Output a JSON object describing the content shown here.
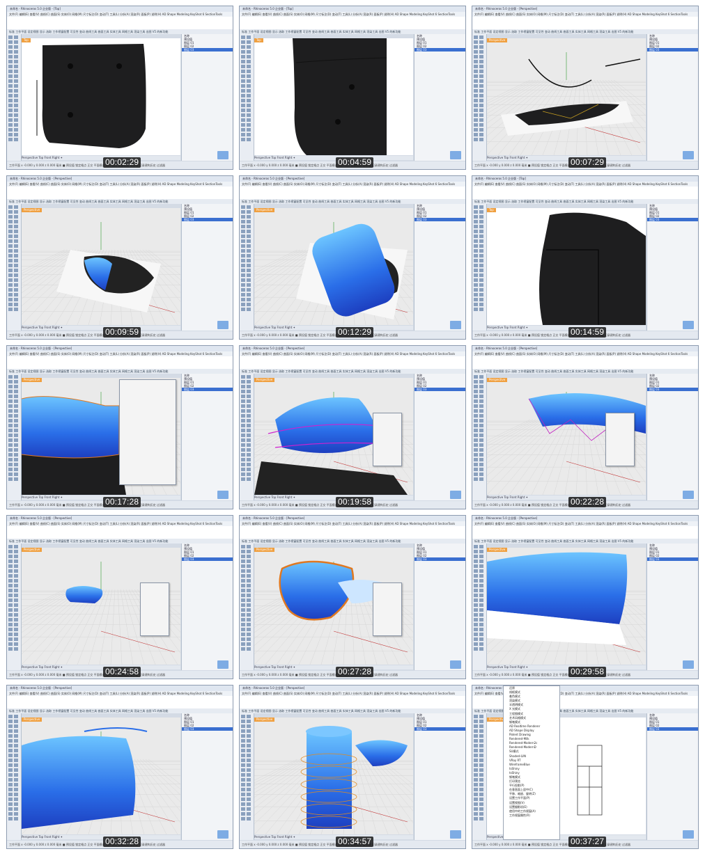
{
  "app": {
    "title_base": "未命名 - Rhinoceros 5.0 企业版",
    "menu": "文件(F)  编辑(E)  查看(V)  曲线(C)  曲面(S)  实体(O)  网格(M)  尺寸标注(D)  变动(T)  工具(L)  分析(A)  渲染(R)  面板(P)  说明(H)  AD Shape Modeling  KeyShot 6  SectionTools",
    "toolbar_tabs": "标准  工作平面  设定视图  显示  选取  工作视窗配置  可见性  变动  曲线工具  曲面工具  实体工具  网格工具  渲染工具  出图  V5 的新功能",
    "viewport_tabs": "Perspective  Top  Front  Right  ✦",
    "status": "工作平面  x -0.000  y 0.000  z 0.000  毫米  ■ 预设值  锁定格点  正交  平面模式  物件锁点  智慧轨迹  操作轴  记录建构历史  过滤器",
    "layers": [
      "名称",
      "预设值",
      "图层 01",
      "图层 02",
      "图层 03"
    ]
  },
  "tiles": [
    {
      "title": "未命名 - Rhinoceros 5.0 企业版 - [Top]",
      "viewport": "Top",
      "timestamp": "00:02:29",
      "scene": "dark-top"
    },
    {
      "title": "未命名 - Rhinoceros 5.0 企业版 - [Top]",
      "viewport": "Top",
      "timestamp": "00:04:59",
      "scene": "dark-top-zoom"
    },
    {
      "title": "未命名 - Rhinoceros 5.0 企业版 - [Perspective]",
      "viewport": "Perspective",
      "timestamp": "00:07:29",
      "scene": "perspective-curves"
    },
    {
      "title": "未命名 - Rhinoceros 5.0 企业版 - [Perspective]",
      "viewport": "Perspective",
      "timestamp": "00:09:59",
      "scene": "perspective-mouse"
    },
    {
      "title": "未命名 - Rhinoceros 5.0 企业版 - [Perspective]",
      "viewport": "Perspective",
      "timestamp": "00:12:29",
      "scene": "perspective-blue"
    },
    {
      "title": "未命名 - Rhinoceros 5.0 企业版 - [Top]",
      "viewport": "Top",
      "timestamp": "00:14:59",
      "scene": "dark-top-curve"
    },
    {
      "title": "未命名 - Rhinoceros 5.0 企业版 - [Perspective]",
      "viewport": "Perspective",
      "timestamp": "00:17:28",
      "scene": "blue-dialog"
    },
    {
      "title": "未命名 - Rhinoceros 5.0 企业版 - [Perspective]",
      "viewport": "Perspective",
      "timestamp": "00:19:58",
      "scene": "blue-magenta"
    },
    {
      "title": "未命名 - Rhinoceros 5.0 企业版 - [Perspective]",
      "viewport": "Perspective",
      "timestamp": "00:22:28",
      "scene": "blue-cage"
    },
    {
      "title": "未命名 - Rhinoceros 5.0 企业版 - [Perspective]",
      "viewport": "Perspective",
      "timestamp": "00:24:58",
      "scene": "small-blue"
    },
    {
      "title": "未命名 - Rhinoceros 5.0 企业版 - [Perspective]",
      "viewport": "Perspective",
      "timestamp": "00:27:28",
      "scene": "blue-orange"
    },
    {
      "title": "未命名 - Rhinoceros 5.0 企业版 - [Perspective]",
      "viewport": "Perspective",
      "timestamp": "00:29:58",
      "scene": "blue-closeup"
    },
    {
      "title": "未命名 - Rhinoceros 5.0 企业版 - [Perspective]",
      "viewport": "Perspective",
      "timestamp": "00:32:28",
      "scene": "blue-flat"
    },
    {
      "title": "未命名 - Rhinoceros 5.0 企业版 - [Perspective]",
      "viewport": "Perspective",
      "timestamp": "00:34:57",
      "scene": "blue-cylinder"
    },
    {
      "title": "未命名 - Rhinoceros 5.0 企业版 - [Perspective]",
      "viewport": "Perspective",
      "timestamp": "00:37:27",
      "scene": "menu"
    }
  ],
  "context_menu": [
    "还原",
    "线框模式",
    "着色模式",
    "渲染模式",
    "半透明模式",
    "X 光模式",
    "工程图模式",
    "艺术风格模式",
    "钢笔模式",
    "AD Realtime Renderer",
    "AD Shape Display",
    "Patent Drawing",
    "Rendered-Milk",
    "Rendered-Modern2c",
    "Rendered-ModernD",
    "SU模式",
    "Shaded-LVN",
    "VRay RT",
    "WireframeBlue",
    "tsShiny",
    "tsShiny",
    "钢笔模式",
    "打印预览",
    "平行投影(P)",
    "在垂直面上居中(C)",
    "平移、缩放、旋转(Z)",
    "设置工作平面(P)",
    "设置视图(V)",
    "设置摄影机(E)",
    "使用中的工作视窗(A)",
    "工作视窗属性(R)"
  ]
}
